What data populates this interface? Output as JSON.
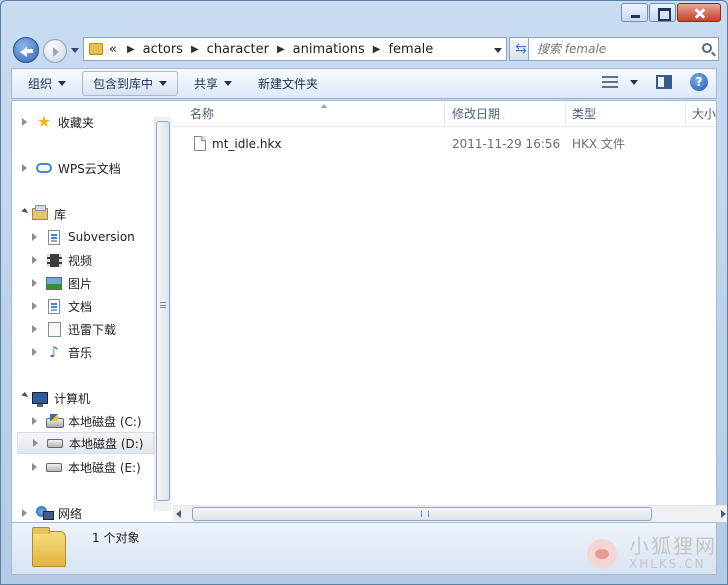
{
  "address": {
    "overflow": "«",
    "crumbs": [
      "actors",
      "character",
      "animations",
      "female"
    ]
  },
  "search": {
    "placeholder": "搜索 female"
  },
  "toolbar": {
    "organize": "组织",
    "include_in_library": "包含到库中",
    "share": "共享",
    "new_folder": "新建文件夹"
  },
  "sidebar": {
    "favorites": "收藏夹",
    "wps_cloud": "WPS云文档",
    "libraries": "库",
    "lib_items": [
      "Subversion",
      "视频",
      "图片",
      "文档",
      "迅雷下载",
      "音乐"
    ],
    "computer": "计算机",
    "drives": [
      "本地磁盘 (C:)",
      "本地磁盘 (D:)",
      "本地磁盘 (E:)"
    ],
    "network": "网络"
  },
  "columns": {
    "name": "名称",
    "modified": "修改日期",
    "type": "类型",
    "size": "大小"
  },
  "files": [
    {
      "name": "mt_idle.hkx",
      "modified": "2011-11-29 16:56",
      "type": "HKX 文件"
    }
  ],
  "status": {
    "count": "1 个对象"
  },
  "watermark": {
    "cn": "小狐狸网",
    "en": "XHLKS.CN"
  }
}
